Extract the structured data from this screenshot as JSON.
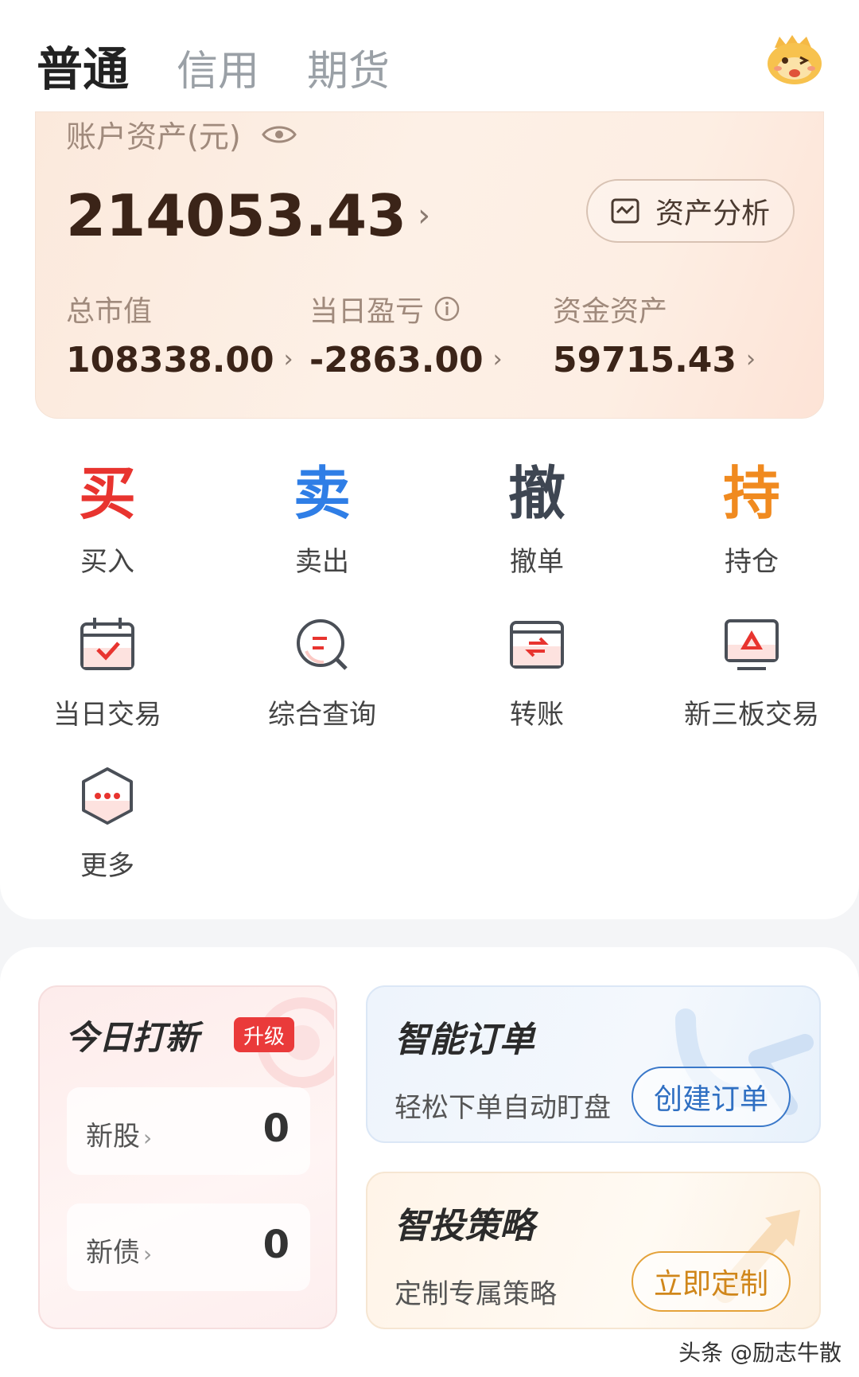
{
  "tabs": [
    {
      "label": "普通",
      "active": true
    },
    {
      "label": "信用",
      "active": false
    },
    {
      "label": "期货",
      "active": false
    }
  ],
  "header": {
    "avatar_icon": "mascot-avatar-icon"
  },
  "asset": {
    "label": "账户资产(元)",
    "total": "214053.43",
    "analysis_label": "资产分析",
    "stats": [
      {
        "label": "总市值",
        "value": "108338.00"
      },
      {
        "label": "当日盈亏",
        "value": "-2863.00"
      },
      {
        "label": "资金资产",
        "value": "59715.43"
      }
    ]
  },
  "trade_actions": [
    {
      "glyph": "买",
      "label": "买入",
      "color": "#e8342f"
    },
    {
      "glyph": "卖",
      "label": "卖出",
      "color": "#2f7ee6"
    },
    {
      "glyph": "撤",
      "label": "撤单",
      "color": "#3e4652"
    },
    {
      "glyph": "持",
      "label": "持仓",
      "color": "#f08a1f"
    }
  ],
  "tools": [
    {
      "label": "当日交易",
      "icon": "calendar-check-icon"
    },
    {
      "label": "综合查询",
      "icon": "search-list-icon"
    },
    {
      "label": "转账",
      "icon": "transfer-card-icon"
    },
    {
      "label": "新三板交易",
      "icon": "monitor-triangle-icon"
    },
    {
      "label": "更多",
      "icon": "more-hexagon-icon"
    }
  ],
  "ipo": {
    "title": "今日打新",
    "badge": "升级",
    "rows": [
      {
        "label": "新股",
        "value": "0"
      },
      {
        "label": "新债",
        "value": "0"
      }
    ]
  },
  "smart_order": {
    "title": "智能订单",
    "subtitle": "轻松下单自动盯盘",
    "button": "创建订单"
  },
  "smart_invest": {
    "title": "智投策略",
    "subtitle": "定制专属策略",
    "button": "立即定制"
  },
  "watermark": "头条 @励志牛散",
  "colors": {
    "accent_red": "#e8342f",
    "accent_blue": "#2f6fc2",
    "accent_orange": "#d0861a",
    "asset_text": "#3b2418"
  }
}
